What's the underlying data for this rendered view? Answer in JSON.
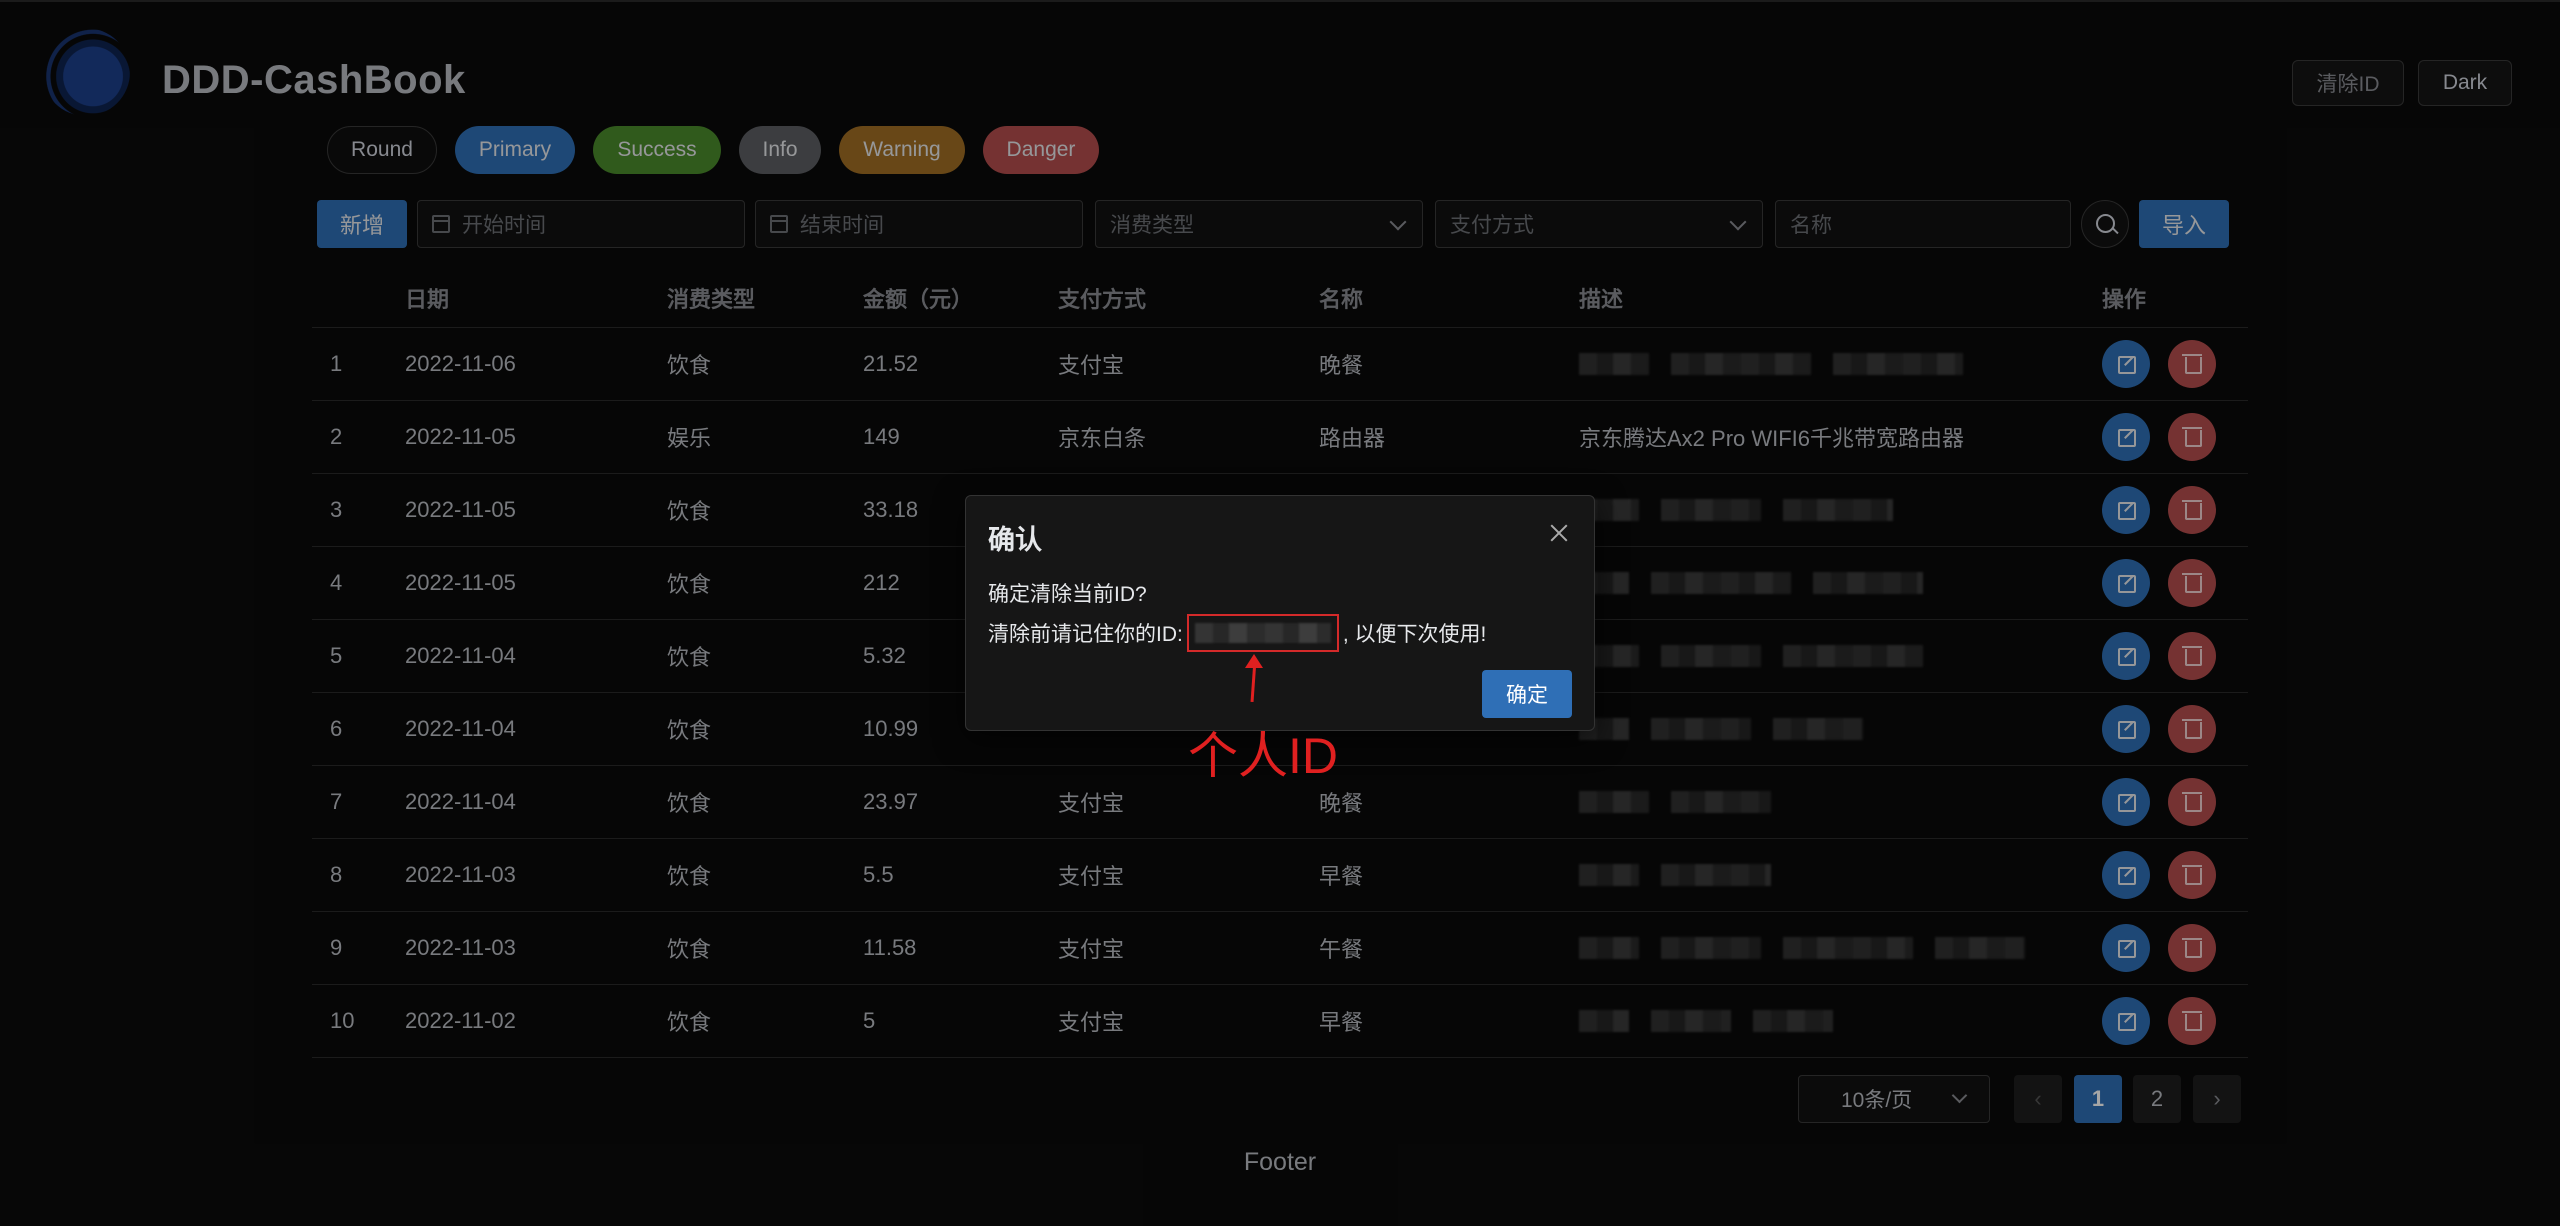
{
  "header": {
    "title": "DDD-CashBook",
    "clear_id_label": "清除ID",
    "dark_label": "Dark"
  },
  "round_buttons": [
    "Round",
    "Primary",
    "Success",
    "Info",
    "Warning",
    "Danger"
  ],
  "filters": {
    "add_label": "新增",
    "start_placeholder": "开始时间",
    "end_placeholder": "结束时间",
    "type_placeholder": "消费类型",
    "pay_placeholder": "支付方式",
    "name_placeholder": "名称",
    "import_label": "导入"
  },
  "table": {
    "headers": {
      "date": "日期",
      "type": "消费类型",
      "amount": "金额（元）",
      "pay": "支付方式",
      "name": "名称",
      "desc": "描述",
      "op": "操作"
    },
    "rows": [
      {
        "idx": "1",
        "date": "2022-11-06",
        "type": "饮食",
        "amount": "21.52",
        "pay": "支付宝",
        "name": "晚餐",
        "desc": ""
      },
      {
        "idx": "2",
        "date": "2022-11-05",
        "type": "娱乐",
        "amount": "149",
        "pay": "京东白条",
        "name": "路由器",
        "desc": "京东腾达Ax2 Pro WIFI6千兆带宽路由器"
      },
      {
        "idx": "3",
        "date": "2022-11-05",
        "type": "饮食",
        "amount": "33.18",
        "pay": "",
        "name": "",
        "desc": ""
      },
      {
        "idx": "4",
        "date": "2022-11-05",
        "type": "饮食",
        "amount": "212",
        "pay": "",
        "name": "",
        "desc": ""
      },
      {
        "idx": "5",
        "date": "2022-11-04",
        "type": "饮食",
        "amount": "5.32",
        "pay": "",
        "name": "",
        "desc": ""
      },
      {
        "idx": "6",
        "date": "2022-11-04",
        "type": "饮食",
        "amount": "10.99",
        "pay": "",
        "name": "",
        "desc": ""
      },
      {
        "idx": "7",
        "date": "2022-11-04",
        "type": "饮食",
        "amount": "23.97",
        "pay": "支付宝",
        "name": "晚餐",
        "desc": ""
      },
      {
        "idx": "8",
        "date": "2022-11-03",
        "type": "饮食",
        "amount": "5.5",
        "pay": "支付宝",
        "name": "早餐",
        "desc": ""
      },
      {
        "idx": "9",
        "date": "2022-11-03",
        "type": "饮食",
        "amount": "11.58",
        "pay": "支付宝",
        "name": "午餐",
        "desc": ""
      },
      {
        "idx": "10",
        "date": "2022-11-02",
        "type": "饮食",
        "amount": "5",
        "pay": "支付宝",
        "name": "早餐",
        "desc": ""
      }
    ]
  },
  "pagination": {
    "page_size": "10条/页",
    "pages": [
      "1",
      "2"
    ],
    "current": "1"
  },
  "footer": "Footer",
  "dialog": {
    "title": "确认",
    "line1": "确定清除当前ID?",
    "line2_prefix": "清除前请记住你的ID:",
    "line2_suffix": ", 以便下次使用!",
    "ok_label": "确定"
  },
  "annotation": "个人ID"
}
